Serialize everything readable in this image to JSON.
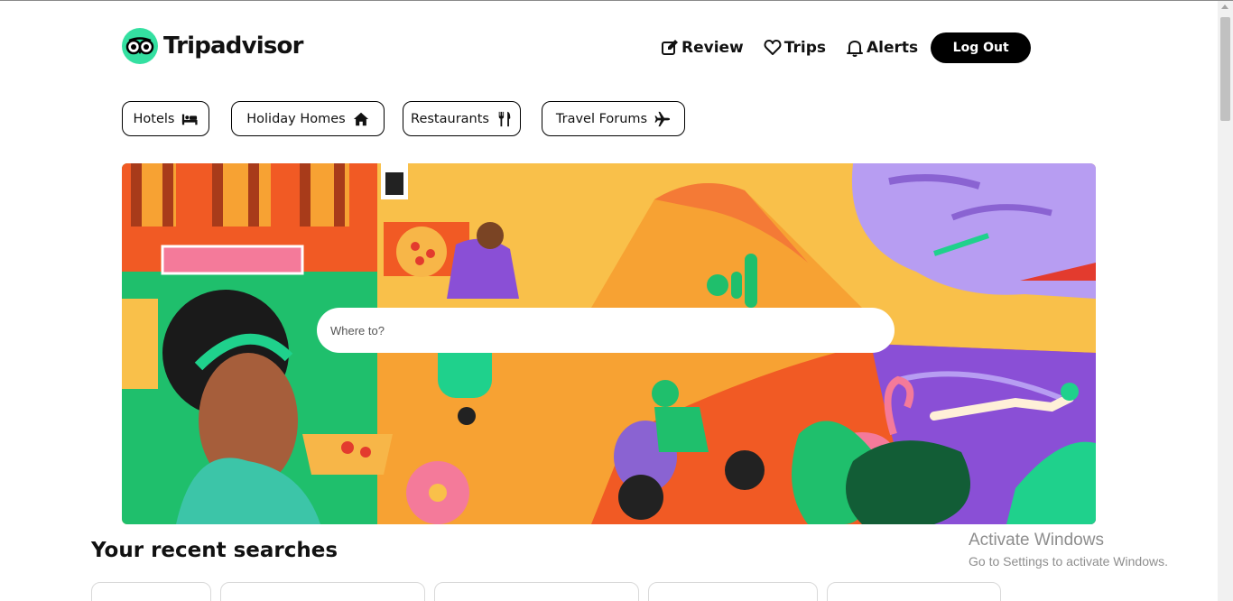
{
  "brand": {
    "name": "Tripadvisor",
    "color": "#34e0a1"
  },
  "topnav": {
    "review": "Review",
    "trips": "Trips",
    "alerts": "Alerts",
    "logout": "Log Out"
  },
  "categories": {
    "hotels": "Hotels",
    "holiday_homes": "Holiday Homes",
    "restaurants": "Restaurants",
    "travel_forums": "Travel Forums"
  },
  "search": {
    "placeholder": "Where to?"
  },
  "recent": {
    "title": "Your recent searches"
  },
  "watermark": {
    "line1": "Activate Windows",
    "line2": "Go to Settings to activate Windows."
  },
  "icons": {
    "review": "edit-icon",
    "trips": "heart-icon",
    "alerts": "bell-icon",
    "hotels": "bed-icon",
    "holiday_homes": "home-icon",
    "restaurants": "utensils-icon",
    "travel_forums": "plane-icon"
  }
}
